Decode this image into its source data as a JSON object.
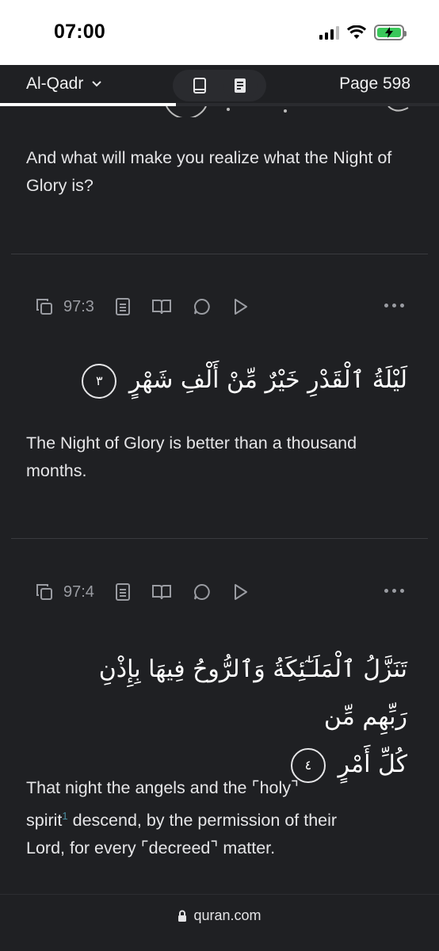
{
  "status_bar": {
    "time": "07:00"
  },
  "header": {
    "chapter_name": "Al-Qadr",
    "page_label": "Page 598",
    "reading_progress_fraction": 0.4
  },
  "verses": [
    {
      "translation": "And what will make you realize what the Night of Glory is?"
    },
    {
      "key": "97:3",
      "arabic": "لَيْلَةُ ٱلْقَدْرِ خَيْرٌ مِّنْ أَلْفِ شَهْرٍ",
      "marker": "٣",
      "translation": "The Night of Glory is better than a thousand months."
    },
    {
      "key": "97:4",
      "arabic_line1": "تَنَزَّلُ ٱلْمَلَـٰٓئِكَةُ وَٱلرُّوحُ فِيهَا بِإِذْنِ رَبِّهِم مِّن",
      "arabic_line2": "كُلِّ أَمْرٍ",
      "marker": "٤",
      "translation_part1": "That night the angels and the ⌜holy⌝",
      "translation_part2": "spirit",
      "footnote": "1",
      "translation_part3": " descend, by the permission of their",
      "translation_part4": "Lord, for every ⌜decreed⌝ matter."
    }
  ],
  "footer": {
    "url": "quran.com"
  },
  "colors": {
    "background": "#1f2023",
    "accent": "#4c8fa3",
    "text": "#e6e6e8"
  }
}
